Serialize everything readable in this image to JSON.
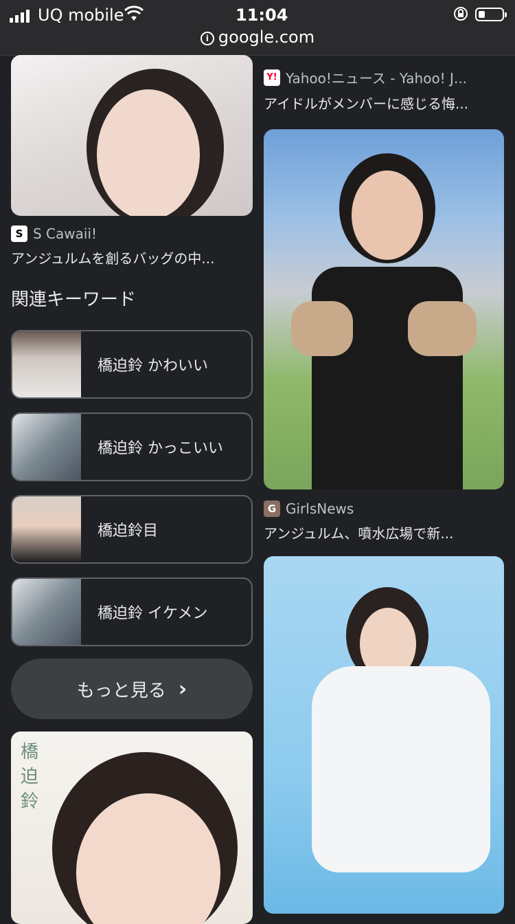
{
  "status_bar": {
    "carrier": "UQ mobile",
    "time": "11:04"
  },
  "url_bar": {
    "domain": "google.com"
  },
  "results": {
    "left_top": {
      "source": "S Cawaii!",
      "caption": "アンジュルムを創るバッグの中..."
    },
    "right_1": {
      "source": "Yahoo!ニュース - Yahoo! J...",
      "caption": "アイドルがメンバーに感じる悔..."
    },
    "right_2": {
      "source": "GirlsNews",
      "caption": "アンジュルム、噴水広場で新..."
    },
    "left_bottom_text": "橋\n迫\n鈴"
  },
  "related": {
    "title": "関連キーワード",
    "items": [
      {
        "label": "橋迫鈴 かわいい"
      },
      {
        "label": "橋迫鈴 かっこいい"
      },
      {
        "label": "橋迫鈴目"
      },
      {
        "label": "橋迫鈴 イケメン"
      }
    ],
    "more_label": "もっと見る",
    "more_icon": "chevron-right-icon"
  },
  "colors": {
    "background": "#202124",
    "border": "#5f6368",
    "button": "#3c4043"
  }
}
